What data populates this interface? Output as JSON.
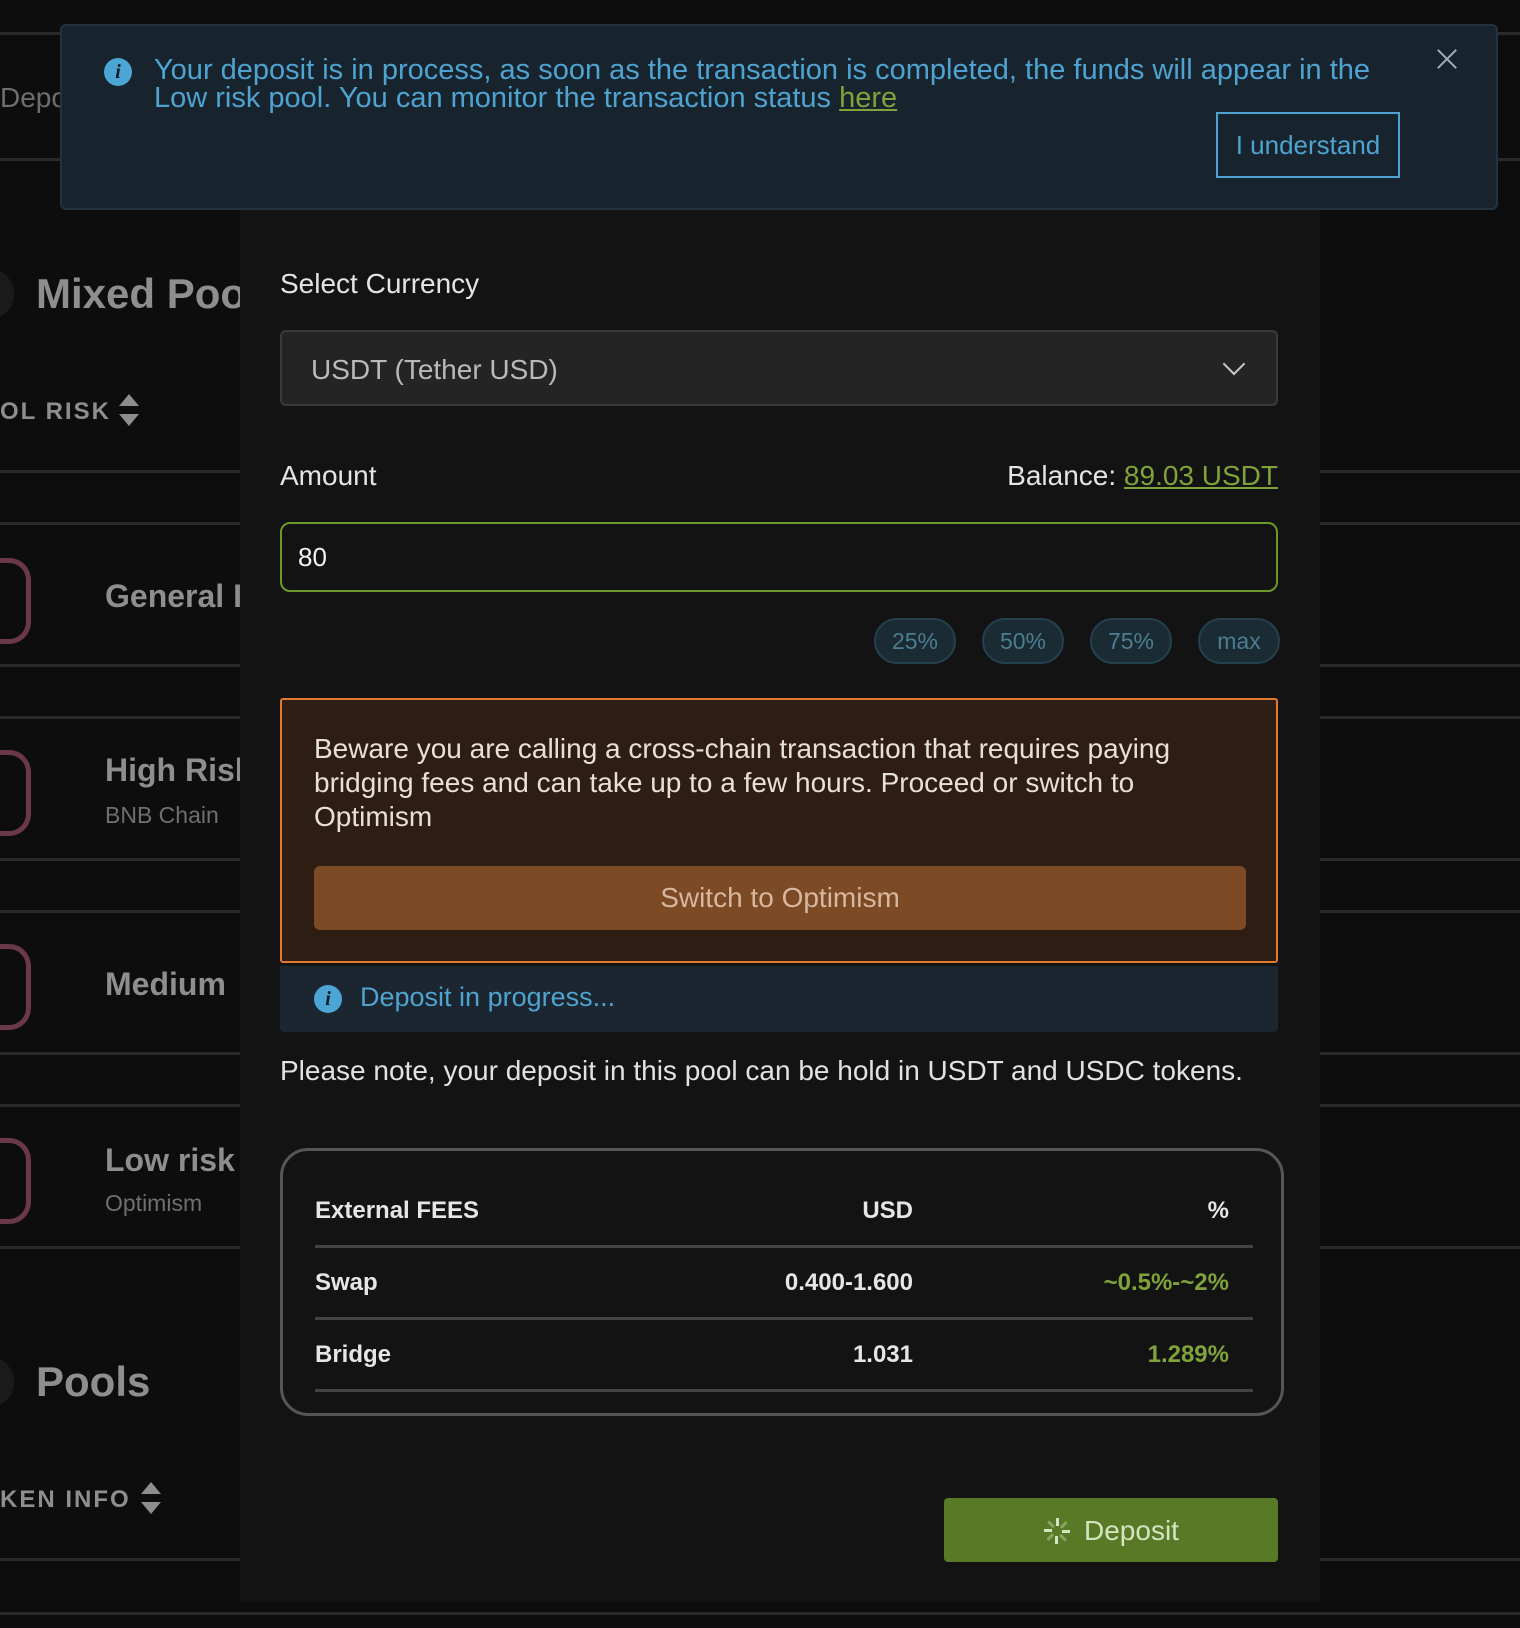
{
  "background": {
    "deposit_tab_fragment": "Depo",
    "mixed_pools_title": "Mixed Poo",
    "pool_risk_header": "OL RISK",
    "pools_title": "Pools",
    "token_info_header": "KEN INFO",
    "rows": [
      {
        "title": "General I",
        "subtitle": ""
      },
      {
        "title": "High Risk",
        "subtitle": "BNB Chain"
      },
      {
        "title": "Medium",
        "subtitle": ""
      },
      {
        "title": "Low risk",
        "subtitle": "Optimism"
      }
    ]
  },
  "toast": {
    "message": "Your deposit is in process, as soon as the transaction is completed, the funds will appear in the Low risk pool. You can monitor the transaction status ",
    "link_text": "here",
    "confirm_label": "I understand"
  },
  "form": {
    "currency_label": "Select Currency",
    "currency_value": "USDT (Tether USD)",
    "amount_label": "Amount",
    "balance_label": "Balance: ",
    "balance_value": "89.03 USDT",
    "amount_value": "80",
    "percent_options": [
      "25%",
      "50%",
      "75%",
      "max"
    ]
  },
  "warning": {
    "text": "Beware you are calling a cross-chain transaction that requires paying bridging fees and can take up to a few hours. Proceed or switch to Optimism",
    "switch_label": "Switch to Optimism"
  },
  "progress": {
    "text": "Deposit in progress..."
  },
  "note": "Please note, your deposit in this pool can be hold in USDT and USDC tokens.",
  "fees": {
    "headers": [
      "External FEES",
      "USD",
      "%"
    ],
    "rows": [
      {
        "name": "Swap",
        "usd": "0.400-1.600",
        "percent": "~0.5%-~2%"
      },
      {
        "name": "Bridge",
        "usd": "1.031",
        "percent": "1.289%"
      }
    ]
  },
  "deposit_button": {
    "label": "Deposit"
  },
  "colors": {
    "accent_green": "#7fa33a",
    "info_blue": "#4fa3d1",
    "warning_orange": "#e07a30"
  }
}
